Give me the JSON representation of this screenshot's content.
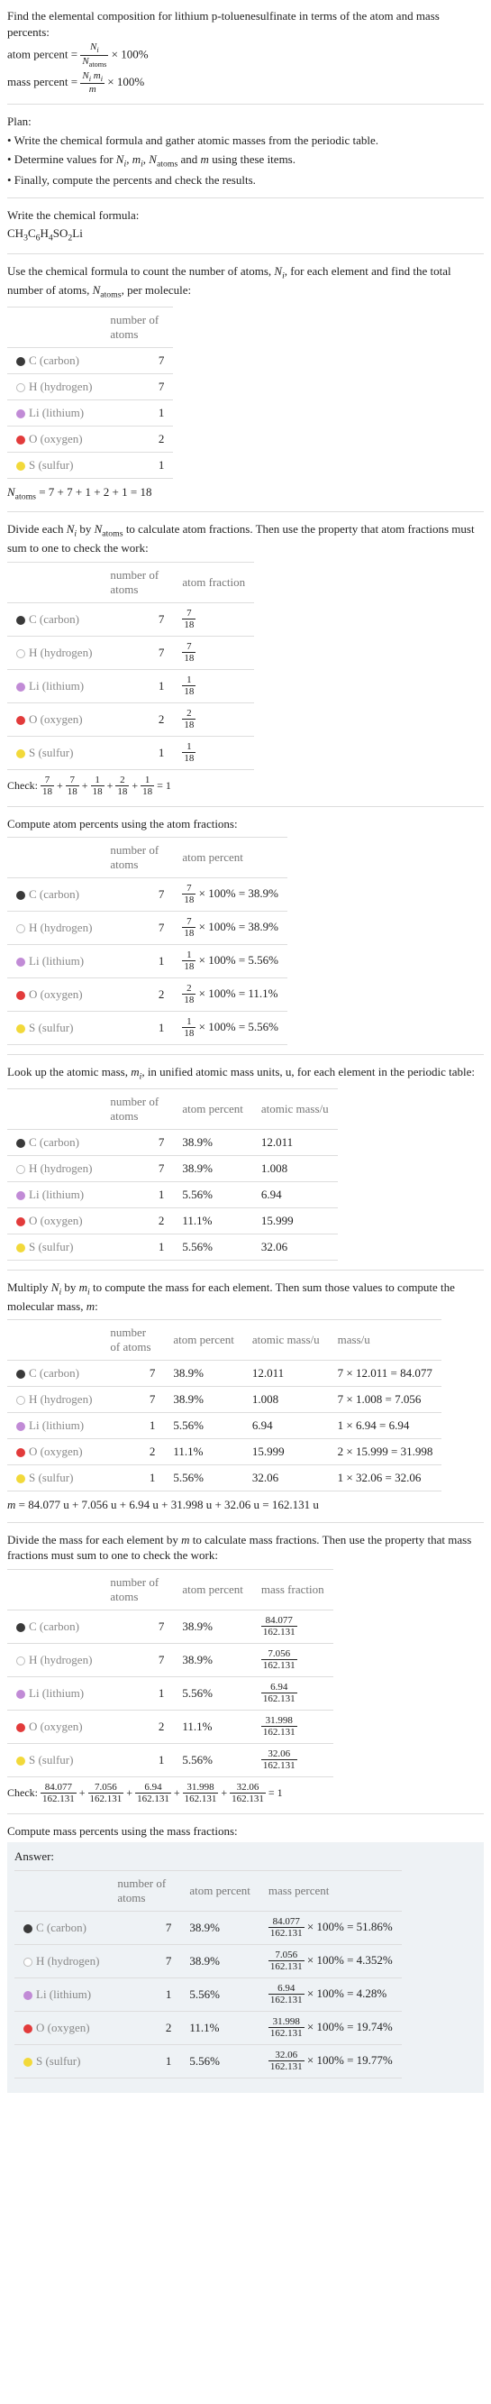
{
  "intro": {
    "prompt": "Find the elemental composition for lithium p-toluenesulfinate in terms of the atom and mass percents:",
    "atom_percent_label": "atom percent =",
    "atom_percent_frac_num": "N_i",
    "atom_percent_frac_den": "N_atoms",
    "times100": "× 100%",
    "mass_percent_label": "mass percent =",
    "mass_percent_frac_num": "N_i m_i",
    "mass_percent_frac_den": "m"
  },
  "plan": {
    "heading": "Plan:",
    "b1": "• Write the chemical formula and gather atomic masses from the periodic table.",
    "b2_left": "• Determine values for ",
    "b2_vars": "N_i, m_i, N_atoms",
    "b2_and": " and ",
    "b2_m": "m",
    "b2_right": " using these items.",
    "b3": "• Finally, compute the percents and check the results."
  },
  "writeFormula": {
    "heading": "Write the chemical formula:",
    "formula_display": "CH3C6H4SO2Li"
  },
  "countAtoms": {
    "intro_a": "Use the chemical formula to count the number of atoms, ",
    "intro_var": "N_i",
    "intro_b": ", for each element and find the total number of atoms, ",
    "intro_var2": "N_atoms",
    "intro_c": ", per molecule:",
    "hdr_atoms": "number of atoms",
    "total_label": "N_atoms",
    "total_expr": " = 7 + 7 + 1 + 2 + 1 = 18"
  },
  "elements": {
    "C": {
      "label": "C (carbon)",
      "color": "#3a3a3a",
      "n": "7",
      "afrac_num": "7",
      "afrac_den": "18",
      "ap": "38.9%",
      "mass": "12.011",
      "mcalc": "7 × 12.011 = 84.077",
      "mf_num": "84.077",
      "mf_den": "162.131",
      "mp": "51.86%",
      "ap_calc": "7/18 × 100% = 38.9%"
    },
    "H": {
      "label": "H (hydrogen)",
      "color": "#ffffff",
      "stroke": "#bbb",
      "n": "7",
      "afrac_num": "7",
      "afrac_den": "18",
      "ap": "38.9%",
      "mass": "1.008",
      "mcalc": "7 × 1.008 = 7.056",
      "mf_num": "7.056",
      "mf_den": "162.131",
      "mp": "4.352%",
      "ap_calc": "7/18 × 100% = 38.9%"
    },
    "Li": {
      "label": "Li (lithium)",
      "color": "#c18bd6",
      "n": "1",
      "afrac_num": "1",
      "afrac_den": "18",
      "ap": "5.56%",
      "mass": "6.94",
      "mcalc": "1 × 6.94 = 6.94",
      "mf_num": "6.94",
      "mf_den": "162.131",
      "mp": "4.28%",
      "ap_calc": "1/18 × 100% = 5.56%"
    },
    "O": {
      "label": "O (oxygen)",
      "color": "#e23b3b",
      "n": "2",
      "afrac_num": "2",
      "afrac_den": "18",
      "ap": "11.1%",
      "mass": "15.999",
      "mcalc": "2 × 15.999 = 31.998",
      "mf_num": "31.998",
      "mf_den": "162.131",
      "mp": "19.74%",
      "ap_calc": "2/18 × 100% = 11.1%"
    },
    "S": {
      "label": "S (sulfur)",
      "color": "#f2d93a",
      "n": "1",
      "afrac_num": "1",
      "afrac_den": "18",
      "ap": "5.56%",
      "mass": "32.06",
      "mcalc": "1 × 32.06 = 32.06",
      "mf_num": "32.06",
      "mf_den": "162.131",
      "mp": "19.77%",
      "ap_calc": "1/18 × 100% = 5.56%"
    }
  },
  "atomFractions": {
    "intro_a": "Divide each ",
    "intro_b": " by ",
    "intro_c": " to calculate atom fractions. Then use the property that atom fractions must sum to one to check the work:",
    "hdr_atoms": "number of atoms",
    "hdr_frac": "atom fraction",
    "check_label": "Check: ",
    "check_end": " = 1"
  },
  "atomPercents": {
    "intro": "Compute atom percents using the atom fractions:",
    "hdr_atoms": "number of atoms",
    "hdr_pct": "atom percent"
  },
  "lookup": {
    "intro_a": "Look up the atomic mass, ",
    "intro_var": "m_i",
    "intro_b": ", in unified atomic mass units, u, for each element in the periodic table:",
    "hdr_atoms": "number of atoms",
    "hdr_pct": "atom percent",
    "hdr_mass": "atomic mass/u"
  },
  "multiply": {
    "intro_a": "Multiply ",
    "intro_b": " by ",
    "intro_c": " to compute the mass for each element. Then sum those values to compute the molecular mass, ",
    "intro_d": ":",
    "hdr_atoms": "number of atoms",
    "hdr_pct": "atom percent",
    "hdr_mass": "atomic mass/u",
    "hdr_massu": "mass/u",
    "sum_label": "m",
    "sum_expr": " = 84.077 u + 7.056 u + 6.94 u + 31.998 u + 32.06 u = 162.131 u"
  },
  "massFractions": {
    "intro_a": "Divide the mass for each element by ",
    "intro_b": " to calculate mass fractions. Then use the property that mass fractions must sum to one to check the work:",
    "hdr_atoms": "number of atoms",
    "hdr_pct": "atom percent",
    "hdr_frac": "mass fraction",
    "check_label": "Check: ",
    "check_end": " = 1"
  },
  "massPercents": {
    "intro": "Compute mass percents using the mass fractions:",
    "answer": "Answer:",
    "hdr_atoms": "number of atoms",
    "hdr_pct": "atom percent",
    "hdr_mp": "mass percent"
  }
}
